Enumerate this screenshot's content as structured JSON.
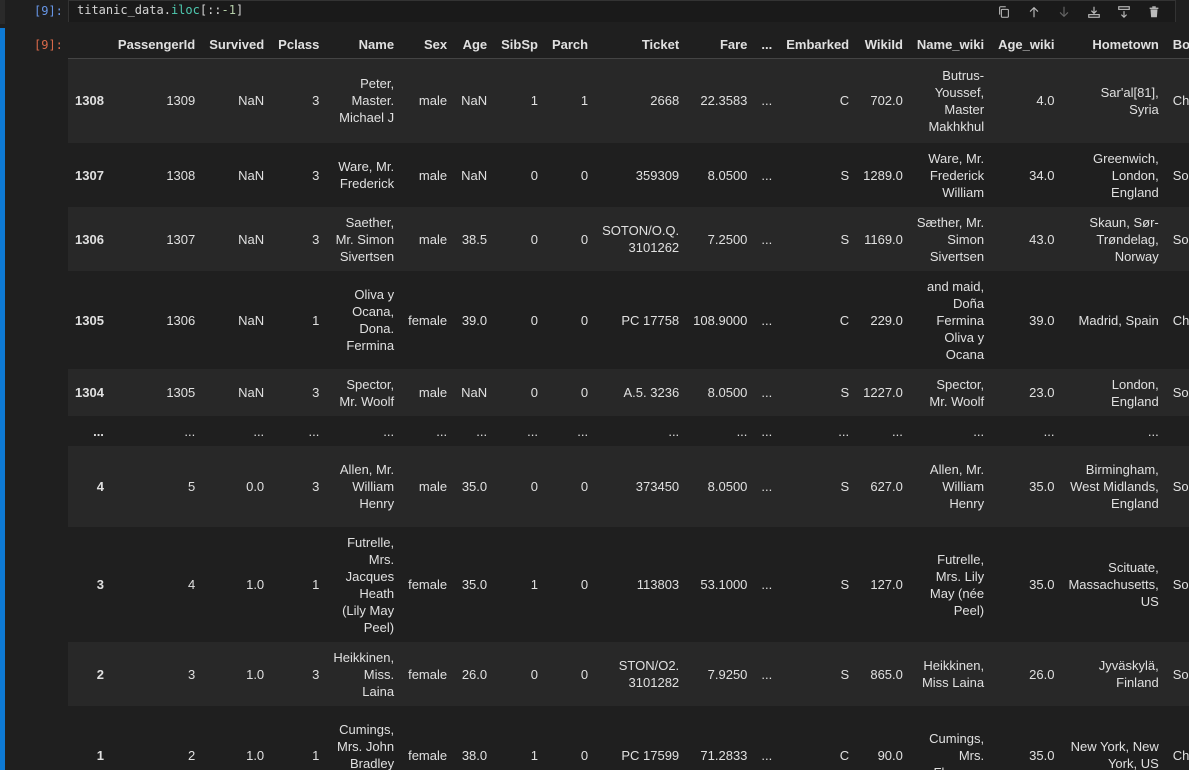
{
  "input_cell": {
    "prompt": "[9]:",
    "code": {
      "var": "titanic_data",
      "dot": ".",
      "attr": "iloc",
      "open": "[::",
      "num": "-1",
      "close": "]"
    },
    "toolbar": [
      {
        "name": "copy-icon",
        "enabled": true
      },
      {
        "name": "arrow-up-icon",
        "enabled": true
      },
      {
        "name": "arrow-down-icon",
        "enabled": false
      },
      {
        "name": "insert-below-icon",
        "enabled": true
      },
      {
        "name": "split-cell-icon",
        "enabled": true
      },
      {
        "name": "trash-icon",
        "enabled": true
      }
    ]
  },
  "output_cell": {
    "prompt": "[9]:",
    "headers": [
      "",
      "PassengerId",
      "Survived",
      "Pclass",
      "Name",
      "Sex",
      "Age",
      "SibSp",
      "Parch",
      "Ticket",
      "Fare",
      "...",
      "Embarked",
      "WikiId",
      "Name_wiki",
      "Age_wiki",
      "Hometown",
      "Boa"
    ],
    "rows": [
      [
        "1308",
        "1309",
        "NaN",
        "3",
        "Peter, Master. Michael J",
        "male",
        "NaN",
        "1",
        "1",
        "2668",
        "22.3583",
        "...",
        "C",
        "702.0",
        "Butrus-Youssef, Master Makhkhul",
        "4.0",
        "Sar'al[81], Syria",
        "Cherb"
      ],
      [
        "1307",
        "1308",
        "NaN",
        "3",
        "Ware, Mr. Frederick",
        "male",
        "NaN",
        "0",
        "0",
        "359309",
        "8.0500",
        "...",
        "S",
        "1289.0",
        "Ware, Mr. Frederick William",
        "34.0",
        "Greenwich, London, England",
        "Southam"
      ],
      [
        "1306",
        "1307",
        "NaN",
        "3",
        "Saether, Mr. Simon Sivertsen",
        "male",
        "38.5",
        "0",
        "0",
        "SOTON/O.Q. 3101262",
        "7.2500",
        "...",
        "S",
        "1169.0",
        "Sæther, Mr. Simon Sivertsen",
        "43.0",
        "Skaun, Sør-Trøndelag, Norway",
        "Southam"
      ],
      [
        "1305",
        "1306",
        "NaN",
        "1",
        "Oliva y Ocana, Dona. Fermina",
        "female",
        "39.0",
        "0",
        "0",
        "PC 17758",
        "108.9000",
        "...",
        "C",
        "229.0",
        "and maid, Doña Fermina Oliva y Ocana",
        "39.0",
        "Madrid, Spain",
        "Cherb"
      ],
      [
        "1304",
        "1305",
        "NaN",
        "3",
        "Spector, Mr. Woolf",
        "male",
        "NaN",
        "0",
        "0",
        "A.5. 3236",
        "8.0500",
        "...",
        "S",
        "1227.0",
        "Spector, Mr. Woolf",
        "23.0",
        "London, England",
        "Southam"
      ],
      [
        "...",
        "...",
        "...",
        "...",
        "...",
        "...",
        "...",
        "...",
        "...",
        "...",
        "...",
        "...",
        "...",
        "...",
        "...",
        "...",
        "...",
        ""
      ],
      [
        "4",
        "5",
        "0.0",
        "3",
        "Allen, Mr. William Henry",
        "male",
        "35.0",
        "0",
        "0",
        "373450",
        "8.0500",
        "...",
        "S",
        "627.0",
        "Allen, Mr. William Henry",
        "35.0",
        "Birmingham, West Midlands, England",
        "Southam"
      ],
      [
        "3",
        "4",
        "1.0",
        "1",
        "Futrelle, Mrs. Jacques Heath (Lily May Peel)",
        "female",
        "35.0",
        "1",
        "0",
        "113803",
        "53.1000",
        "...",
        "S",
        "127.0",
        "Futrelle, Mrs. Lily May (née Peel)",
        "35.0",
        "Scituate, Massachusetts, US",
        "Southam"
      ],
      [
        "2",
        "3",
        "1.0",
        "3",
        "Heikkinen, Miss. Laina",
        "female",
        "26.0",
        "0",
        "0",
        "STON/O2. 3101282",
        "7.9250",
        "...",
        "S",
        "865.0",
        "Heikkinen, Miss Laina",
        "26.0",
        "Jyväskylä, Finland",
        "Southam"
      ],
      [
        "1",
        "2",
        "1.0",
        "1",
        "Cumings, Mrs. John Bradley (Florence",
        "female",
        "38.0",
        "1",
        "0",
        "PC 17599",
        "71.2833",
        "...",
        "C",
        "90.0",
        "Cumings, Mrs. Florence",
        "35.0",
        "New York, New York, US",
        "Cherb"
      ]
    ]
  },
  "colors": {
    "active_cell_bar": "#0e7ad4",
    "in_prompt": "#6796e6",
    "out_prompt": "#d9694a",
    "row_odd": "#282828",
    "row_even": "#1f1f1f"
  }
}
